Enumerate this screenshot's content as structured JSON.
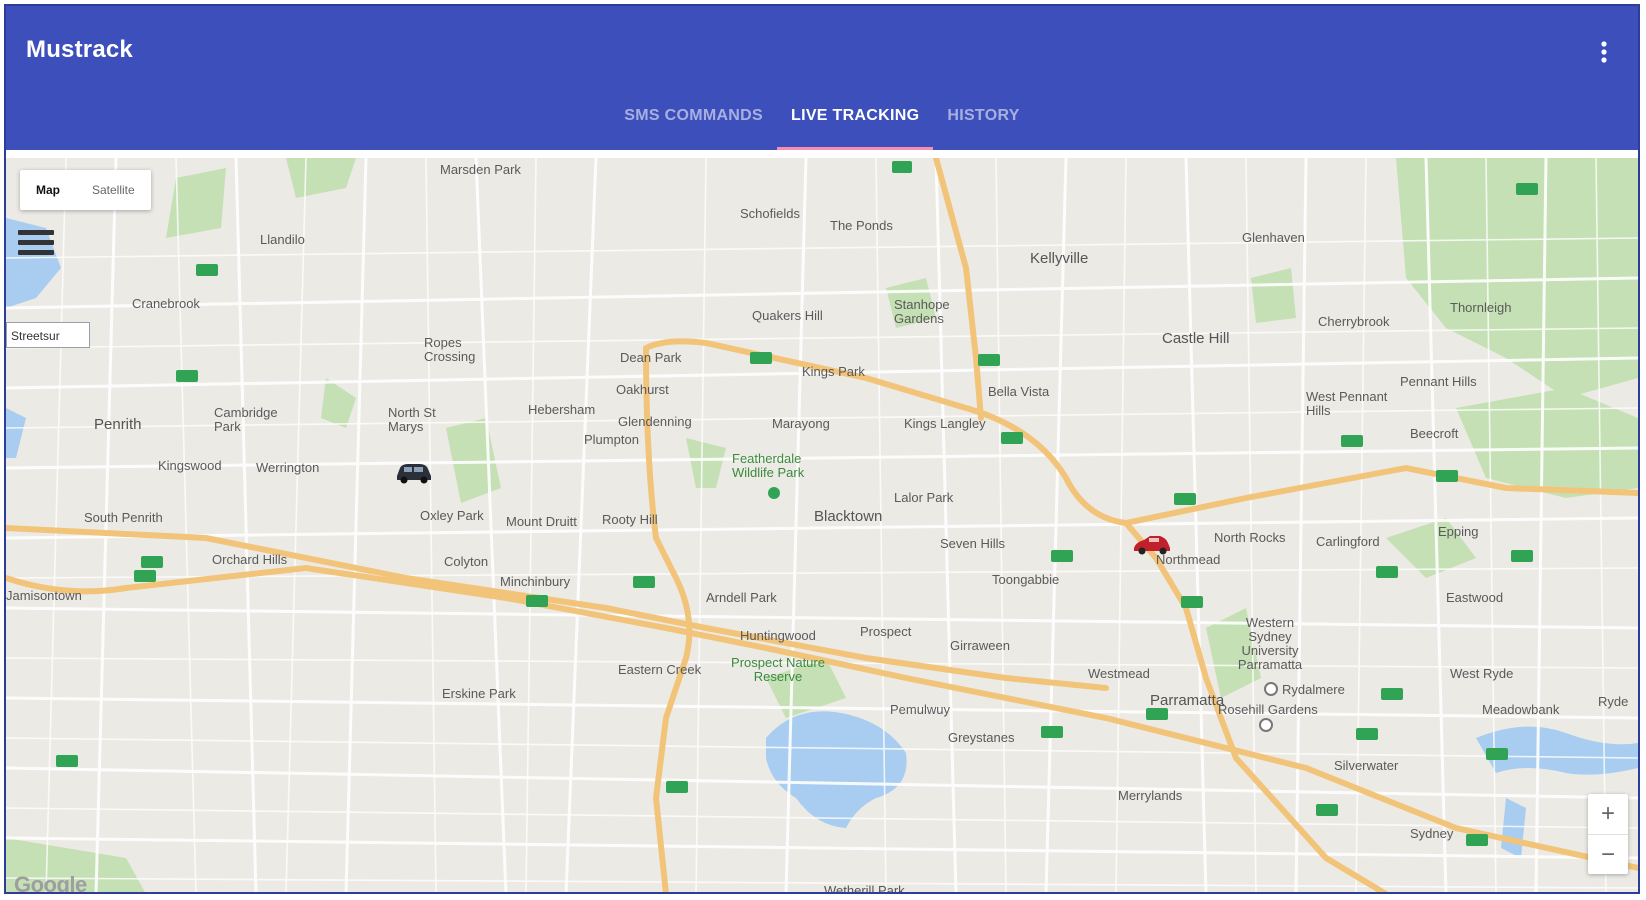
{
  "app": {
    "title": "Mustrack",
    "menu_icon": "more-vert-icon"
  },
  "tabs": [
    {
      "label": "SMS COMMANDS",
      "active": false
    },
    {
      "label": "LIVE TRACKING",
      "active": true
    },
    {
      "label": "HISTORY",
      "active": false
    }
  ],
  "colors": {
    "appbar": "#3c4fba",
    "tab_indicator": "#f48fb1",
    "map_bg": "#eceae5",
    "motorway": "#f2c47a",
    "water": "#a8cdf0",
    "park": "#c5e0b4"
  },
  "map": {
    "type_options": [
      {
        "label": "Map",
        "selected": true
      },
      {
        "label": "Satellite",
        "selected": false
      }
    ],
    "search_text": "Streetsur",
    "logo_text": "Google",
    "zoom_in_label": "+",
    "zoom_out_label": "−",
    "bottom_place": "Wetherill Park",
    "vehicles": [
      {
        "name": "vehicle-black-car",
        "color": "#2a2f3a"
      },
      {
        "name": "vehicle-red-car",
        "color": "#c0212b"
      }
    ],
    "places": [
      {
        "id": "marsden-park",
        "name": "Marsden Park"
      },
      {
        "id": "schofields",
        "name": "Schofields"
      },
      {
        "id": "the-ponds",
        "name": "The Ponds"
      },
      {
        "id": "glenhaven",
        "name": "Glenhaven"
      },
      {
        "id": "llandilo",
        "name": "Llandilo"
      },
      {
        "id": "kellyville",
        "name": "Kellyville"
      },
      {
        "id": "cranebrook",
        "name": "Cranebrook"
      },
      {
        "id": "quakers-hill",
        "name": "Quakers Hill"
      },
      {
        "id": "stanhope-gardens",
        "name": "Stanhope Gardens"
      },
      {
        "id": "castle-hill",
        "name": "Castle Hill"
      },
      {
        "id": "cherrybrook",
        "name": "Cherrybrook"
      },
      {
        "id": "thornleigh",
        "name": "Thornleigh"
      },
      {
        "id": "ropes-crossing",
        "name": "Ropes Crossing"
      },
      {
        "id": "dean-park",
        "name": "Dean Park"
      },
      {
        "id": "kings-park",
        "name": "Kings Park"
      },
      {
        "id": "oakhurst",
        "name": "Oakhurst"
      },
      {
        "id": "bella-vista",
        "name": "Bella Vista"
      },
      {
        "id": "pennant-hills",
        "name": "Pennant Hills"
      },
      {
        "id": "penrith",
        "name": "Penrith"
      },
      {
        "id": "cambridge-park",
        "name": "Cambridge Park"
      },
      {
        "id": "north-st-marys",
        "name": "North St Marys"
      },
      {
        "id": "hebersham",
        "name": "Hebersham"
      },
      {
        "id": "glendenning",
        "name": "Glendenning"
      },
      {
        "id": "marayong",
        "name": "Marayong"
      },
      {
        "id": "kings-langley",
        "name": "Kings Langley"
      },
      {
        "id": "west-pennant-hills",
        "name": "West Pennant Hills"
      },
      {
        "id": "beecroft",
        "name": "Beecroft"
      },
      {
        "id": "plumpton",
        "name": "Plumpton"
      },
      {
        "id": "kingswood",
        "name": "Kingswood"
      },
      {
        "id": "werrington",
        "name": "Werrington"
      },
      {
        "id": "featherdale",
        "name": "Featherdale Wildlife Park"
      },
      {
        "id": "lalor-park",
        "name": "Lalor Park"
      },
      {
        "id": "south-penrith",
        "name": "South Penrith"
      },
      {
        "id": "oxley-park",
        "name": "Oxley Park"
      },
      {
        "id": "mount-druitt",
        "name": "Mount Druitt"
      },
      {
        "id": "rooty-hill",
        "name": "Rooty Hill"
      },
      {
        "id": "blacktown",
        "name": "Blacktown"
      },
      {
        "id": "seven-hills",
        "name": "Seven Hills"
      },
      {
        "id": "north-rocks",
        "name": "North Rocks"
      },
      {
        "id": "carlingford",
        "name": "Carlingford"
      },
      {
        "id": "epping",
        "name": "Epping"
      },
      {
        "id": "northmead",
        "name": "Northmead"
      },
      {
        "id": "orchard-hills",
        "name": "Orchard Hills"
      },
      {
        "id": "colyton",
        "name": "Colyton"
      },
      {
        "id": "toongabbie",
        "name": "Toongabbie"
      },
      {
        "id": "minchinbury",
        "name": "Minchinbury"
      },
      {
        "id": "jamisontown",
        "name": "Jamisontown"
      },
      {
        "id": "arndell-park",
        "name": "Arndell Park"
      },
      {
        "id": "eastwood",
        "name": "Eastwood"
      },
      {
        "id": "western-sydney-uni",
        "name": "Western Sydney University Parramatta"
      },
      {
        "id": "huntingwood",
        "name": "Huntingwood"
      },
      {
        "id": "prospect",
        "name": "Prospect"
      },
      {
        "id": "girraween",
        "name": "Girraween"
      },
      {
        "id": "eastern-creek",
        "name": "Eastern Creek"
      },
      {
        "id": "prospect-reserve",
        "name": "Prospect Nature Reserve"
      },
      {
        "id": "westmead",
        "name": "Westmead"
      },
      {
        "id": "west-ryde",
        "name": "West Ryde"
      },
      {
        "id": "rydalmere",
        "name": "Rydalmere"
      },
      {
        "id": "erskine-park",
        "name": "Erskine Park"
      },
      {
        "id": "parramatta",
        "name": "Parramatta"
      },
      {
        "id": "rosehill-gardens",
        "name": "Rosehill Gardens"
      },
      {
        "id": "meadowbank",
        "name": "Meadowbank"
      },
      {
        "id": "pemulwuy",
        "name": "Pemulwuy"
      },
      {
        "id": "greystanes",
        "name": "Greystanes"
      },
      {
        "id": "silverwater",
        "name": "Silverwater"
      },
      {
        "id": "merrylands",
        "name": "Merrylands"
      },
      {
        "id": "sydney",
        "name": "Sydney"
      },
      {
        "id": "ryde",
        "name": "Ryde"
      }
    ]
  }
}
